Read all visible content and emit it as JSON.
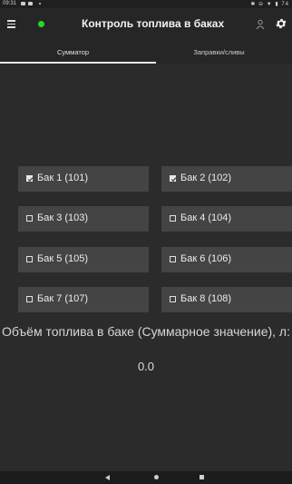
{
  "statusbar": {
    "time": "09:31",
    "right_text": "✱ ⊖ ▼ ▮ 74"
  },
  "appbar": {
    "title": "Контроль топлива в баках"
  },
  "tabs": [
    {
      "label": "Сумматор",
      "selected": true
    },
    {
      "label": "Заправки/сливы",
      "selected": false
    }
  ],
  "tanks": [
    {
      "label": "Бак 1 (101)",
      "checked": true
    },
    {
      "label": "Бак 2 (102)",
      "checked": true
    },
    {
      "label": "Бак 3 (103)",
      "checked": false
    },
    {
      "label": "Бак 4 (104)",
      "checked": false
    },
    {
      "label": "Бак 5 (105)",
      "checked": false
    },
    {
      "label": "Бак 6 (106)",
      "checked": false
    },
    {
      "label": "Бак 7 (107)",
      "checked": false
    },
    {
      "label": "Бак 8 (108)",
      "checked": false
    }
  ],
  "summary": {
    "label": "Объём топлива в баке (Суммарное значение), л:",
    "value": "0.0"
  },
  "colors": {
    "status_dot": "#22dd22",
    "tank_bg": "#444444",
    "background": "#2b2b2b"
  }
}
